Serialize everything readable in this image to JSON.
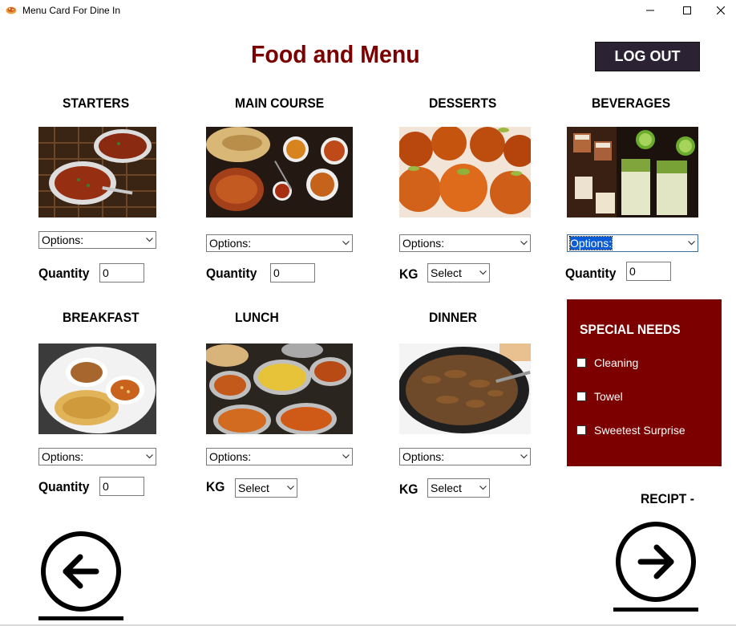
{
  "window": {
    "title": "Menu Card For Dine In"
  },
  "header": {
    "title": "Food and Menu",
    "logout_label": "LOG OUT"
  },
  "categories": [
    {
      "name": "STARTERS",
      "dropdown": "Options:",
      "qty_label": "Quantity",
      "qty_value": "0"
    },
    {
      "name": "MAIN COURSE",
      "dropdown": "Options:",
      "qty_label": "Quantity",
      "qty_value": "0"
    },
    {
      "name": "DESSERTS",
      "dropdown": "Options:",
      "qty_label": "KG",
      "select_value": "Select"
    },
    {
      "name": "BEVERAGES",
      "dropdown": "Options:",
      "qty_label": "Quantity",
      "qty_value": "0"
    },
    {
      "name": "BREAKFAST",
      "dropdown": "Options:",
      "qty_label": "Quantity",
      "qty_value": "0"
    },
    {
      "name": "LUNCH",
      "dropdown": "Options:",
      "qty_label": "KG",
      "select_value": "Select"
    },
    {
      "name": "DINNER",
      "dropdown": "Options:",
      "qty_label": "KG",
      "select_value": "Select"
    }
  ],
  "special_needs": {
    "title": "SPECIAL NEEDS",
    "options": [
      {
        "label": "Cleaning",
        "checked": false
      },
      {
        "label": "Towel",
        "checked": false
      },
      {
        "label": "Sweetest Surprise",
        "checked": false
      }
    ]
  },
  "receipt": {
    "label": "RECIPT -"
  },
  "icons": {
    "app": "food-plate-icon",
    "back": "arrow-left-circle-icon",
    "next": "arrow-right-circle-icon"
  },
  "colors": {
    "title": "#7b0000",
    "special_panel": "#7d0000",
    "logout_bg": "#2b2334"
  }
}
